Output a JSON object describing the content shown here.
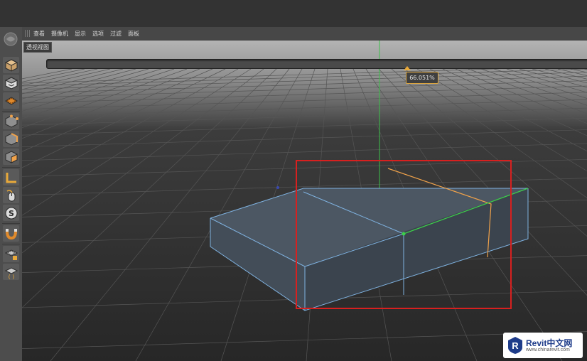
{
  "menubar": {
    "items": [
      "查看",
      "摄像机",
      "显示",
      "选项",
      "过滤",
      "面板"
    ]
  },
  "viewport": {
    "label": "透视视图"
  },
  "slider": {
    "value_label": "66.051%",
    "value": 0.66
  },
  "tools": [
    {
      "name": "model-mode-icon"
    },
    {
      "name": "texture-mode-icon"
    },
    {
      "name": "workplane-mode-icon"
    },
    {
      "name": "points-mode-icon"
    },
    {
      "name": "edges-mode-icon"
    },
    {
      "name": "polygons-mode-icon"
    },
    {
      "name": "axis-mode-icon"
    },
    {
      "name": "tweak-mode-icon"
    },
    {
      "name": "solo-mode-icon"
    },
    {
      "name": "snap-icon"
    },
    {
      "name": "workplane-lock-icon"
    },
    {
      "name": "planar-workplane-icon"
    }
  ],
  "watermark": {
    "title": "Revit中文网",
    "url": "www.chinarevit.com"
  },
  "colors": {
    "selection_rect": "#d8201f",
    "object_edge": "#7fb2e0",
    "loop_cut": "#f0a24a",
    "selected_edge": "#3cd04a",
    "slider_accent": "#e8a93a"
  }
}
